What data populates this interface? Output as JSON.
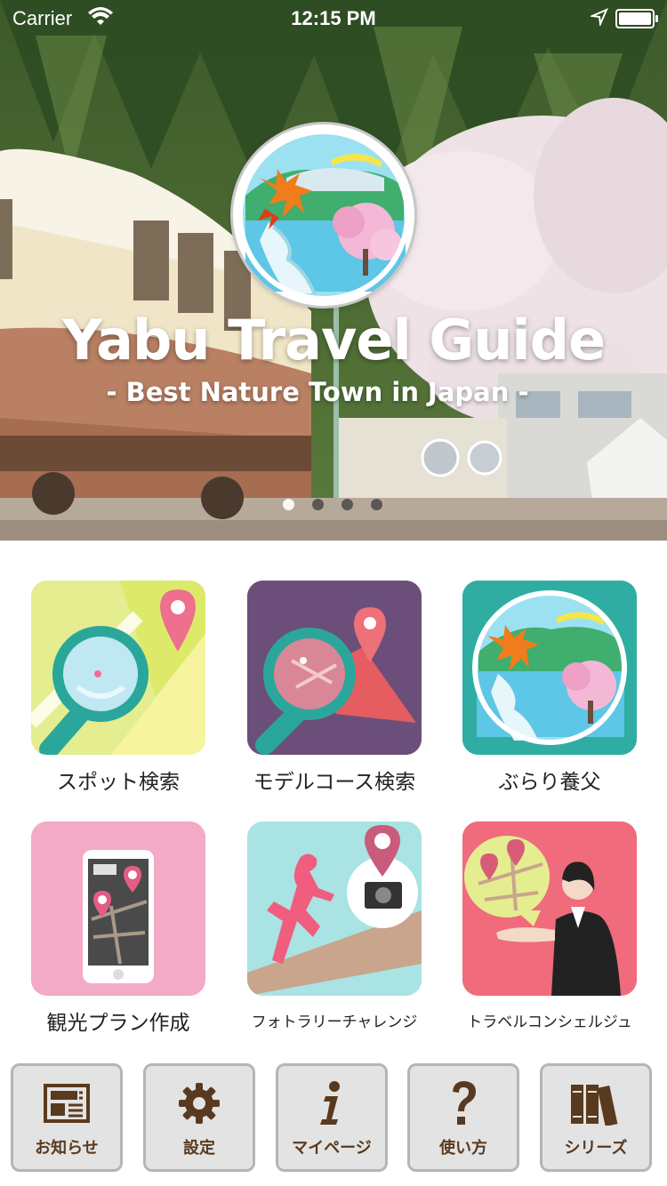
{
  "status_bar": {
    "carrier": "Carrier",
    "time": "12:15 PM"
  },
  "hero": {
    "title": "Yabu Travel Guide",
    "subtitle": "- Best Nature Town in Japan -",
    "slides_total": 4,
    "active_slide": 1
  },
  "menu": [
    {
      "label": "スポット検索",
      "icon": "spot-search-icon"
    },
    {
      "label": "モデルコース検索",
      "icon": "model-course-search-icon"
    },
    {
      "label": "ぶらり養父",
      "icon": "burari-yabu-icon"
    },
    {
      "label": "観光プラン作成",
      "icon": "plan-creation-icon"
    },
    {
      "label": "フォトラリーチャレンジ",
      "icon": "photo-rally-icon"
    },
    {
      "label": "トラベルコンシェルジュ",
      "icon": "travel-concierge-icon"
    }
  ],
  "toolbar": [
    {
      "label": "お知らせ",
      "icon": "news-icon"
    },
    {
      "label": "設定",
      "icon": "gear-icon"
    },
    {
      "label": "マイページ",
      "icon": "info-icon"
    },
    {
      "label": "使い方",
      "icon": "help-icon"
    },
    {
      "label": "シリーズ",
      "icon": "books-icon"
    }
  ],
  "colors": {
    "tile_spot": "#e4ed8f",
    "tile_course": "#6b4f7a",
    "tile_burari": "#2fada3",
    "tile_plan": "#f2aac7",
    "tile_photo": "#a9e3e3",
    "tile_concierge": "#f06b7b",
    "toolbar_text": "#5a3a1e"
  }
}
